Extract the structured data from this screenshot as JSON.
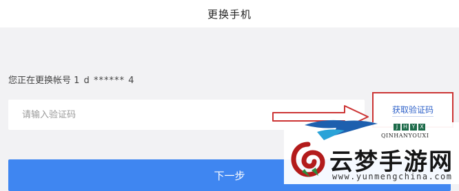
{
  "header": {
    "title": "更换手机"
  },
  "account": {
    "prefix": "您正在更换帐号",
    "masked_number": "1 d ****** 4"
  },
  "verify": {
    "code_placeholder": "请输入验证码",
    "get_code_label": "获取验证码"
  },
  "actions": {
    "next_label": "下一步"
  },
  "watermark": {
    "badge_letters": [
      "J",
      "H",
      "Y",
      "X"
    ],
    "pinyin": "QINHANYOUXI",
    "title": "云梦手游网",
    "url": "www.yunmengchina.com"
  },
  "colors": {
    "primary_button": "#3f86f1",
    "annotation": "#cc3333",
    "link": "#2f62c9"
  }
}
